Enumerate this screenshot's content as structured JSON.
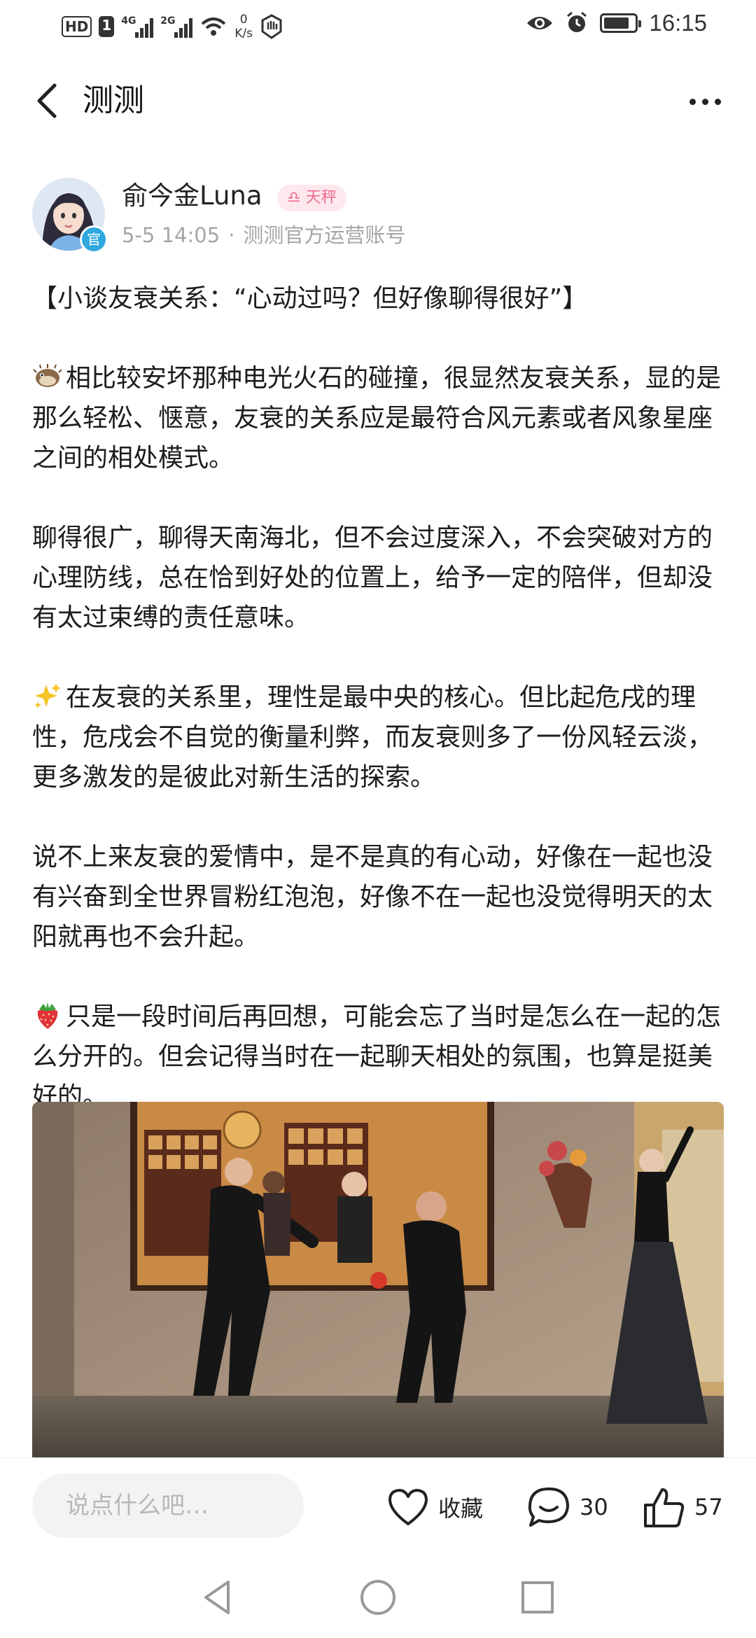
{
  "status_bar": {
    "hd_badge": "HD",
    "sim_badge": "1",
    "signal1_label": "4G",
    "signal2_label": "2G",
    "net_speed_value": "0",
    "net_speed_unit": "K/s",
    "time": "16:15",
    "battery_level": 0.85,
    "icons": [
      "eye-icon",
      "alarm-icon",
      "battery-icon",
      "wifi-icon",
      "hand-icon"
    ]
  },
  "nav": {
    "title": "测测"
  },
  "author": {
    "name": "俞今金Luna",
    "zodiac_symbol": "♎",
    "zodiac": "天秤",
    "verified_label": "官",
    "date": "5-5 14:05",
    "separator": "·",
    "role": "测测官方运营账号"
  },
  "article": {
    "paragraphs": [
      {
        "emoji": "",
        "text": "【小谈友衰关系：“心动过吗？但好像聊得很好”】"
      },
      {
        "emoji": "pufferfish",
        "text": "相比较安坏那种电光火石的碰撞，很显然友衰关系，显的是那么轻松、惬意，友衰的关系应是最符合风元素或者风象星座之间的相处模式。"
      },
      {
        "emoji": "",
        "text": "聊得很广，聊得天南海北，但不会过度深入，不会突破对方的心理防线，总在恰到好处的位置上，给予一定的陪伴，但却没有太过束缚的责任意味。"
      },
      {
        "emoji": "sparkles",
        "text": "在友衰的关系里，理性是最中央的核心。但比起危戌的理性，危戌会不自觉的衡量利弊，而友衰则多了一份风轻云淡，更多激发的是彼此对新生活的探索。"
      },
      {
        "emoji": "",
        "text": "说不上来友衰的爱情中，是不是真的有心动，好像在一起也没有兴奋到全世界冒粉红泡泡，好像不在一起也没觉得明天的太阳就再也不会升起。"
      },
      {
        "emoji": "strawberry",
        "text": "只是一段时间后再回想，可能会忘了当时是怎么在一起的怎么分开的。但会记得当时在一起聊天相处的氛围，也算是挺美好的。"
      }
    ]
  },
  "bottom_bar": {
    "comment_placeholder": "说点什么吧…",
    "favorite_label": "收藏",
    "comment_count": "30",
    "like_count": "57"
  },
  "colors": {
    "accent_pink": "#f06a8d",
    "zodiac_bg": "#fde8ee",
    "verified_blue": "#2fa8e0",
    "meta_gray": "#a5a5a5"
  }
}
